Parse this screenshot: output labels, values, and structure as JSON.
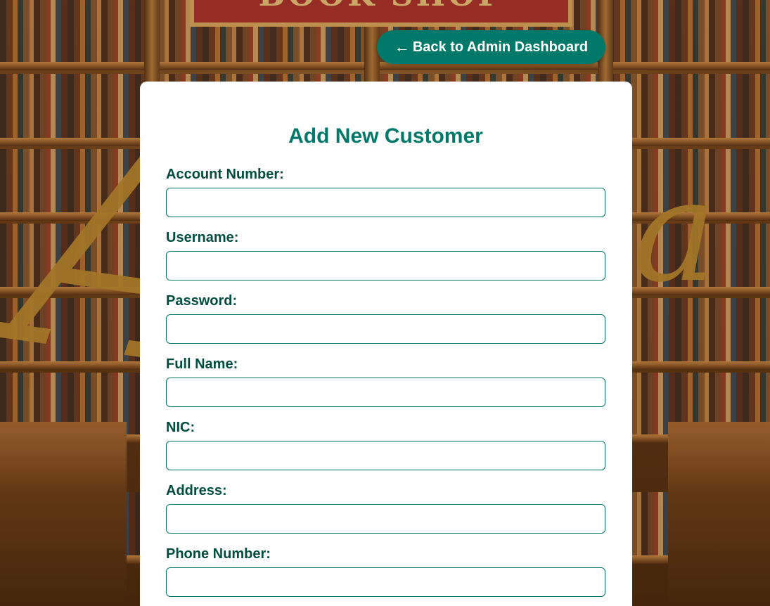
{
  "background": {
    "sign_text": "BOOK SHOP"
  },
  "header": {
    "back_arrow": "←",
    "back_label": "Back to Admin Dashboard"
  },
  "form": {
    "title": "Add New Customer",
    "fields": [
      {
        "label": "Account Number:",
        "value": "",
        "type": "text"
      },
      {
        "label": "Username:",
        "value": "",
        "type": "text"
      },
      {
        "label": "Password:",
        "value": "",
        "type": "password"
      },
      {
        "label": "Full Name:",
        "value": "",
        "type": "text"
      },
      {
        "label": "NIC:",
        "value": "",
        "type": "text"
      },
      {
        "label": "Address:",
        "value": "",
        "type": "text"
      },
      {
        "label": "Phone Number:",
        "value": "",
        "type": "text"
      }
    ]
  },
  "colors": {
    "accent": "#00796b",
    "label": "#004d40",
    "card": "#ffffff"
  }
}
